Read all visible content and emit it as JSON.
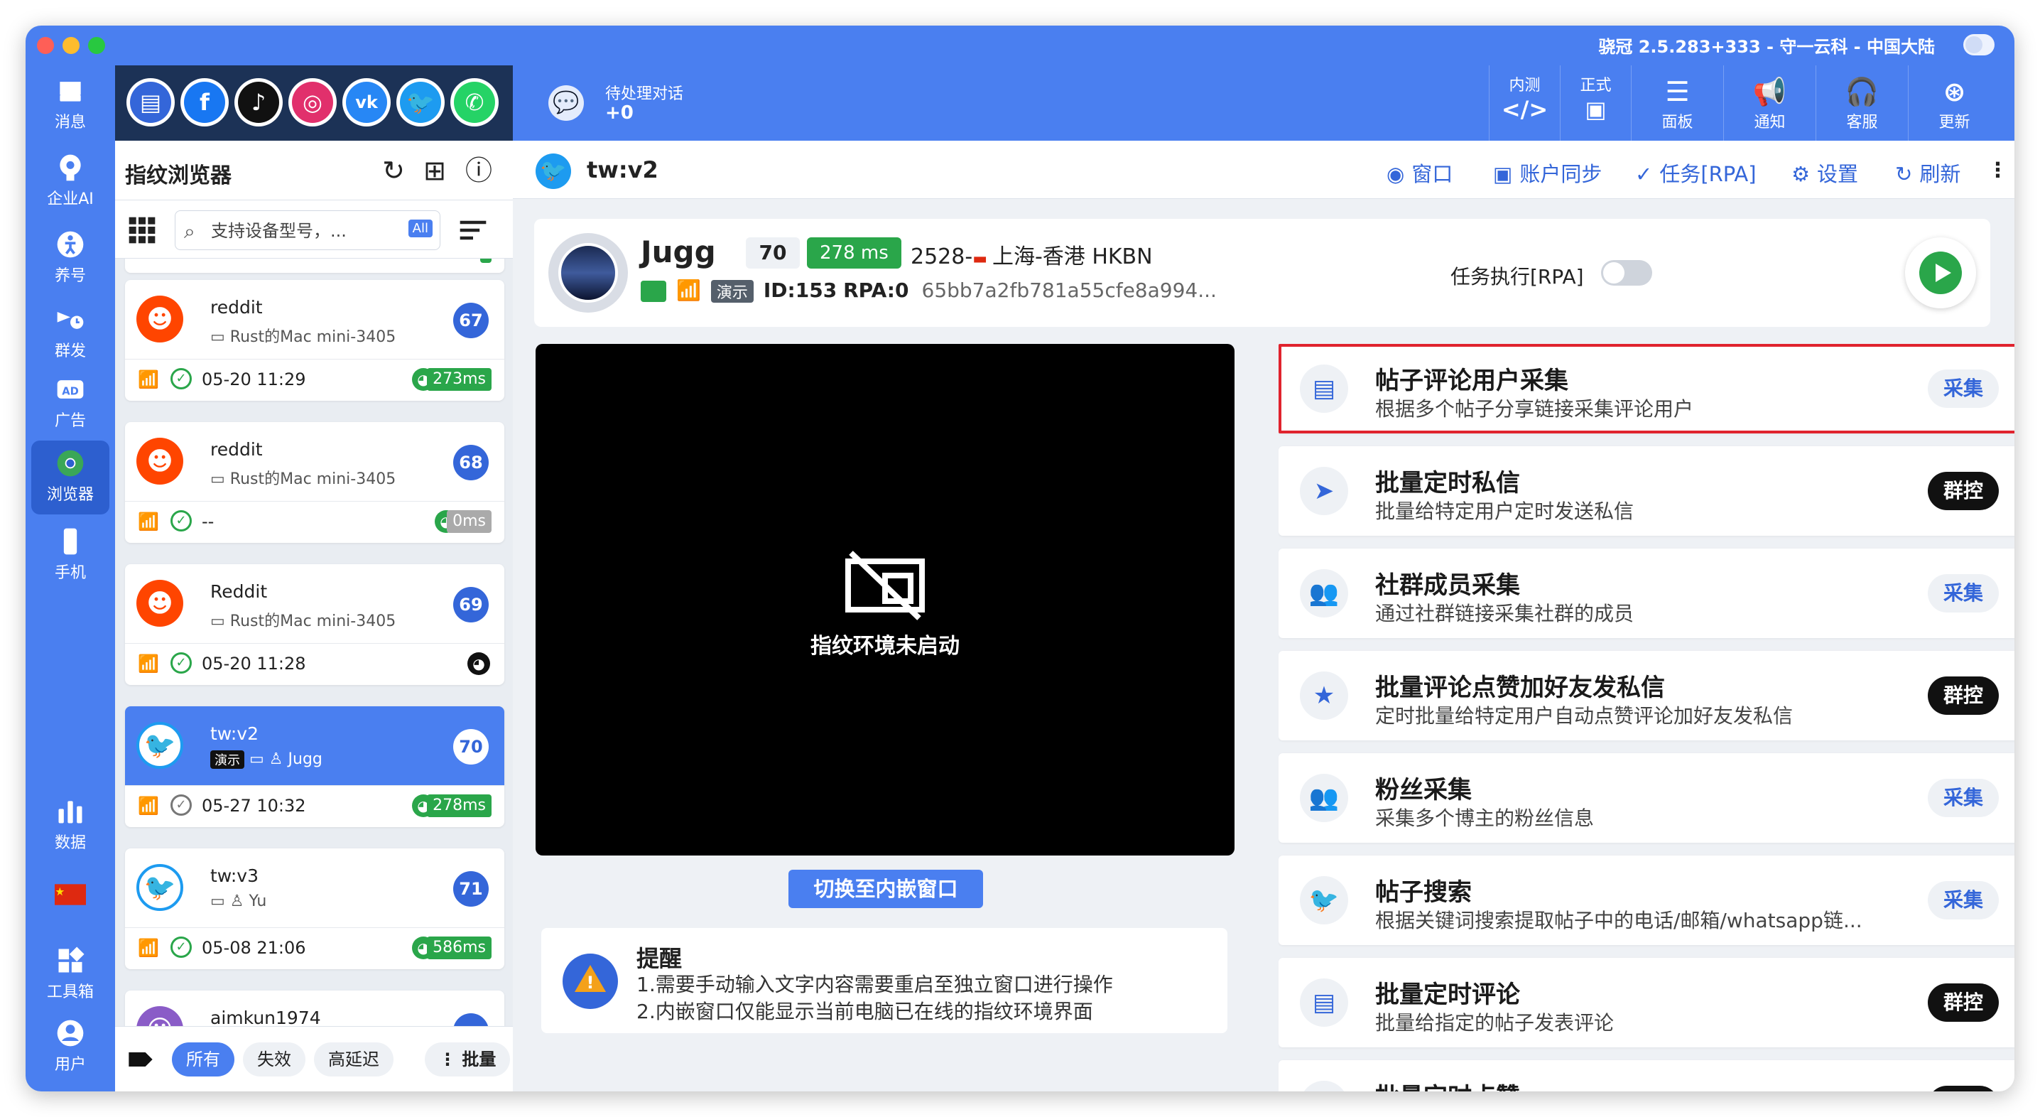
{
  "window": {
    "title": "骁冠 2.5.283+333 - 守一云科 - 中国大陆"
  },
  "rail": {
    "items": [
      {
        "label": "消息",
        "icon": "inbox-icon"
      },
      {
        "label": "企业AI",
        "icon": "ai-brain-icon"
      },
      {
        "label": "养号",
        "icon": "person-walk-icon"
      },
      {
        "label": "群发",
        "icon": "broadcast-icon"
      },
      {
        "label": "广告",
        "icon": "ad-icon"
      },
      {
        "label": "浏览器",
        "icon": "browser-icon"
      },
      {
        "label": "手机",
        "icon": "phone-icon"
      },
      {
        "label": "数据",
        "icon": "bar-chart-icon"
      },
      {
        "label": "",
        "icon": "china-flag-icon"
      },
      {
        "label": "工具箱",
        "icon": "toolbox-icon"
      },
      {
        "label": "用户",
        "icon": "user-icon"
      }
    ],
    "active": "浏览器"
  },
  "brands": [
    "desktop-app",
    "facebook",
    "tiktok",
    "instagram",
    "vk",
    "twitter",
    "whatsapp"
  ],
  "sidebar": {
    "title": "指纹浏览器",
    "search_placeholder": "支持设备型号，...",
    "all_badge": "All",
    "cards": [
      {
        "name": "reddit",
        "device": "Rust的Mac mini-3405",
        "num": "67",
        "date": "05-20 11:29",
        "latency": "273ms",
        "status": "ok"
      },
      {
        "name": "reddit",
        "device": "Rust的Mac mini-3405",
        "num": "68",
        "date": "--",
        "latency": "0ms",
        "status": "ok"
      },
      {
        "name": "Reddit",
        "device": "Rust的Mac mini-3405",
        "num": "69",
        "date": "05-20 11:28",
        "latency": "",
        "status": "ok"
      },
      {
        "name": "tw:v2",
        "demo": "演示",
        "user": "Jugg",
        "num": "70",
        "date": "05-27 10:32",
        "latency": "278ms",
        "status": "idle"
      },
      {
        "name": "tw:v3",
        "user": "Yu",
        "num": "71",
        "date": "05-08 21:06",
        "latency": "586ms",
        "status": "ok"
      },
      {
        "name": "aimkun1974",
        "num": ""
      }
    ],
    "footer": {
      "all": "所有",
      "invalid": "失效",
      "high_latency": "高延迟",
      "batch": "批量"
    }
  },
  "topbar": {
    "pending_label": "待处理对话",
    "pending_count": "+0",
    "buttons": [
      {
        "top": "内测",
        "bottom": "</>"
      },
      {
        "top": "正式",
        "bottom": "▣"
      },
      {
        "icon": "sliders-icon",
        "label": "面板"
      },
      {
        "icon": "megaphone-icon",
        "label": "通知"
      },
      {
        "icon": "headset-icon",
        "label": "客服"
      },
      {
        "icon": "update-icon",
        "label": "更新"
      }
    ]
  },
  "main": {
    "title": "tw:v2",
    "actions": {
      "window": "窗口",
      "account_sync": "账户同步",
      "task": "任务[RPA]",
      "settings": "设置",
      "refresh": "刷新"
    }
  },
  "profile": {
    "name": "Jugg",
    "score": "70",
    "latency": "278 ms",
    "location_prefix": "2528-",
    "location": "上海-香港 HKBN",
    "demo": "演示",
    "id": "ID:153",
    "rpa": "RPA:0",
    "hash": "65bb7a2fb781a55cfe8a994...",
    "rpa_label": "任务执行[RPA]",
    "rpa_enabled": false
  },
  "viewer": {
    "message": "指纹环境未启动",
    "switch_button": "切换至内嵌窗口"
  },
  "notice": {
    "title": "提醒",
    "lines": [
      "1.需要手动输入文字内容需要重启至独立窗口进行操作",
      "2.内嵌窗口仅能显示当前电脑已在线的指纹环境界面"
    ]
  },
  "tasks": [
    {
      "title": "帖子评论用户采集",
      "desc": "根据多个帖子分享链接采集评论用户",
      "btn": "采集",
      "type": "col",
      "icon": "comment-icon"
    },
    {
      "title": "批量定时私信",
      "desc": "批量给特定用户定时发送私信",
      "btn": "群控",
      "type": "grp",
      "icon": "send-icon"
    },
    {
      "title": "社群成员采集",
      "desc": "通过社群链接采集社群的成员",
      "btn": "采集",
      "type": "col",
      "icon": "group-icon"
    },
    {
      "title": "批量评论点赞加好友发私信",
      "desc": "定时批量给特定用户自动点赞评论加好友发私信",
      "btn": "群控",
      "type": "grp",
      "icon": "star-ticket-icon"
    },
    {
      "title": "粉丝采集",
      "desc": "采集多个博主的粉丝信息",
      "btn": "采集",
      "type": "col",
      "icon": "people-icon"
    },
    {
      "title": "帖子搜索",
      "desc": "根据关键词搜索提取帖子中的电话/邮箱/whatsapp链...",
      "btn": "采集",
      "type": "col",
      "icon": "twitter-bird-icon"
    },
    {
      "title": "批量定时评论",
      "desc": "批量给指定的帖子发表评论",
      "btn": "群控",
      "type": "grp",
      "icon": "comment-icon"
    },
    {
      "title": "批量定时点赞",
      "desc": "",
      "btn": "群控",
      "type": "grp",
      "icon": "like-icon"
    }
  ],
  "colors": {
    "primary": "#4a7ff0",
    "dark_navy": "#1c3256",
    "success": "#2aa64a",
    "highlight": "#e0232e"
  }
}
